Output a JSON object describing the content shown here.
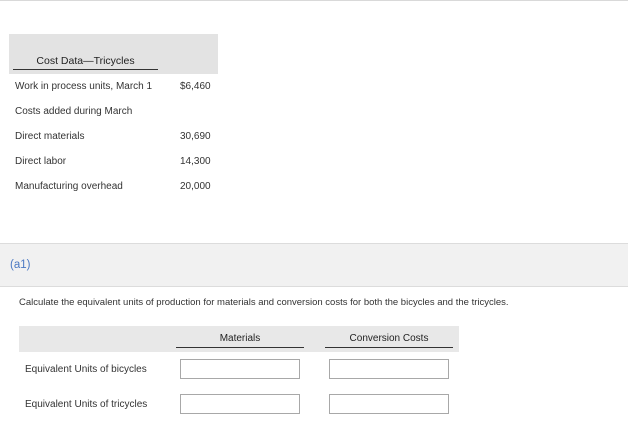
{
  "cost_table": {
    "title": "Cost Data—Tricycles",
    "rows": [
      {
        "label": "Work in process units, March 1",
        "value": "$6,460"
      },
      {
        "label": "Costs added during March",
        "value": ""
      },
      {
        "label": "Direct materials",
        "value": "30,690"
      },
      {
        "label": "Direct labor",
        "value": "14,300"
      },
      {
        "label": "Manufacturing overhead",
        "value": "20,000"
      }
    ]
  },
  "section": {
    "label": "(a1)",
    "question": "Calculate the equivalent units of production for materials and conversion costs for both the bicycles and the tricycles."
  },
  "eq_table": {
    "columns": [
      "Materials",
      "Conversion Costs"
    ],
    "rows": [
      {
        "label": "Equivalent Units of bicycles",
        "materials_value": "",
        "conversion_value": ""
      },
      {
        "label": "Equivalent Units of tricycles",
        "materials_value": "",
        "conversion_value": ""
      }
    ]
  }
}
